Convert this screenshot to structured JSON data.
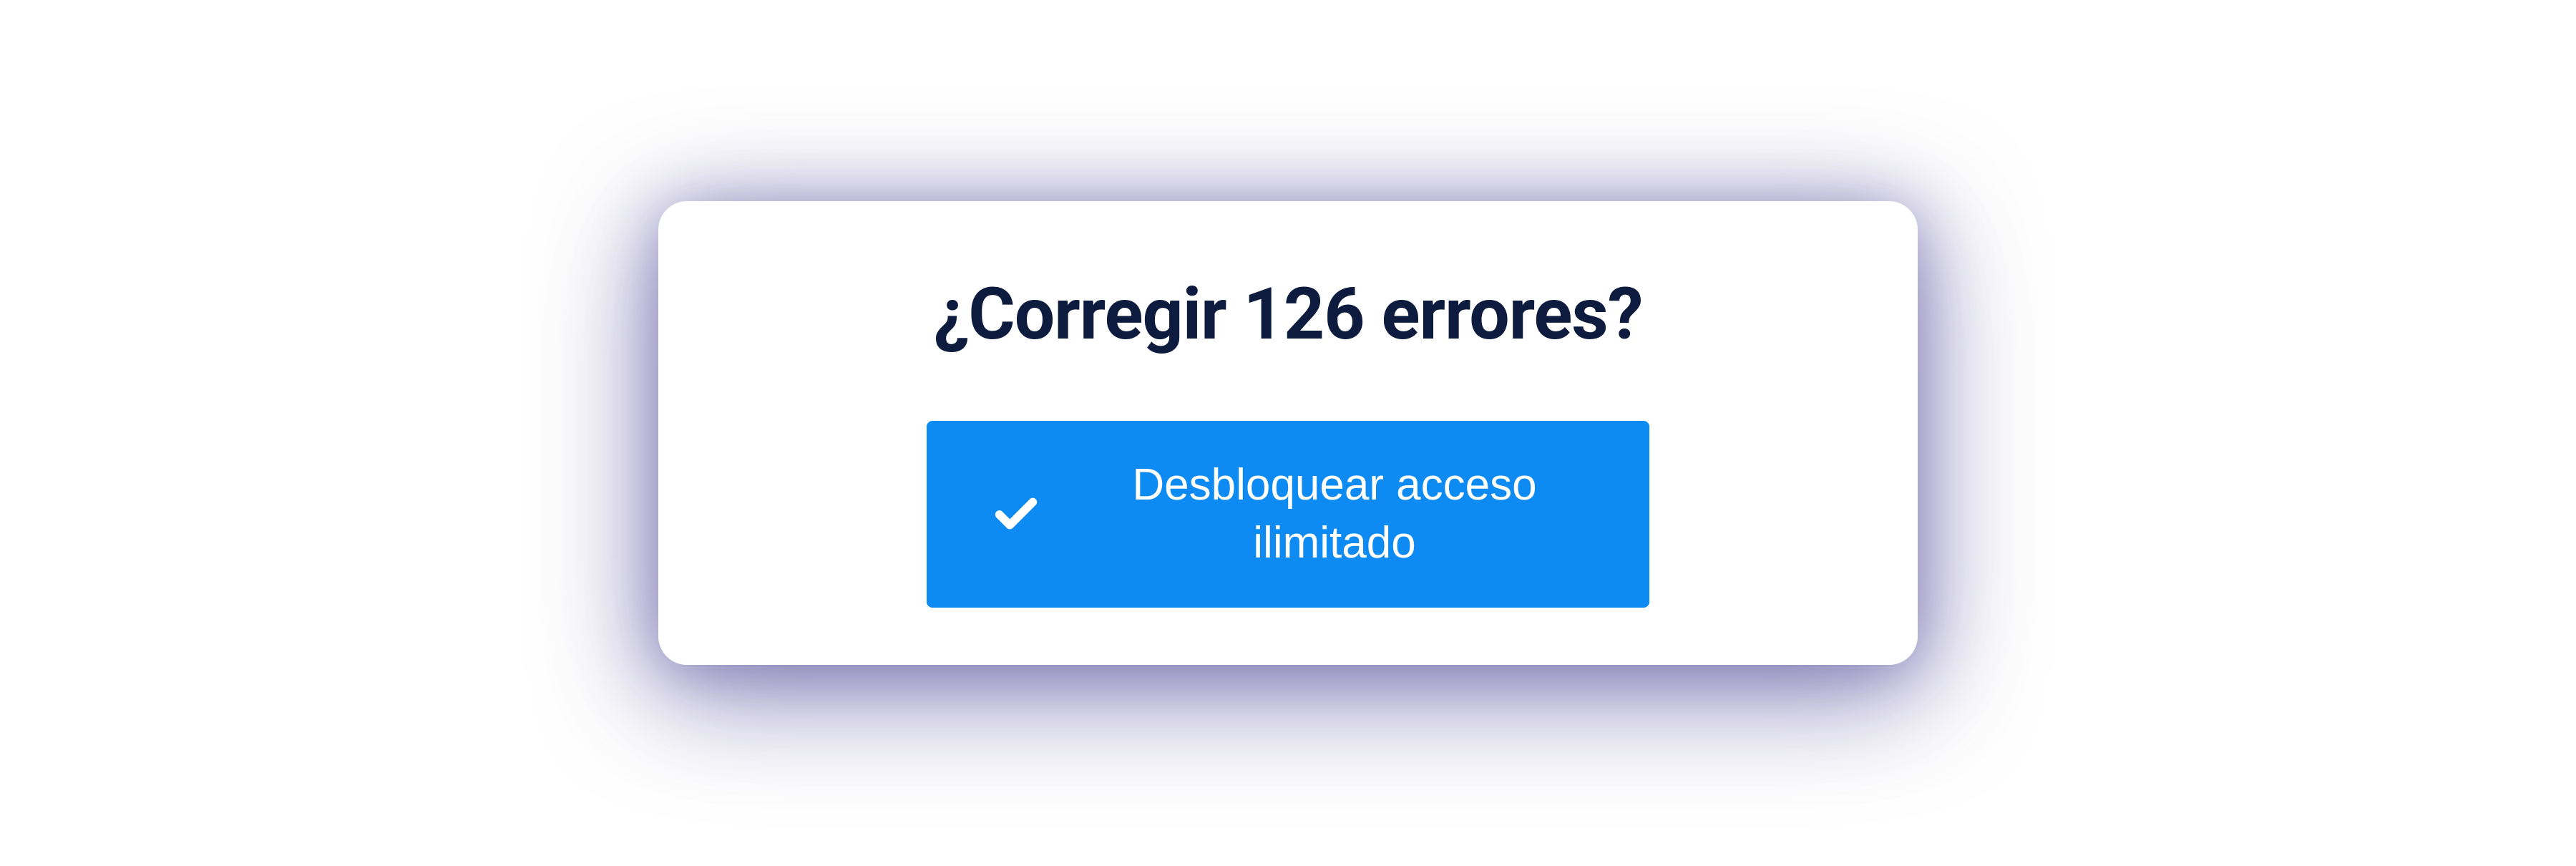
{
  "dialog": {
    "title": "¿Corregir 126 errores?",
    "button": {
      "label": "Desbloquear acceso ilimitado",
      "icon": "check-icon"
    }
  },
  "colors": {
    "accent": "#0d8bf2",
    "title": "#0d1b3e",
    "card_bg": "#ffffff"
  }
}
